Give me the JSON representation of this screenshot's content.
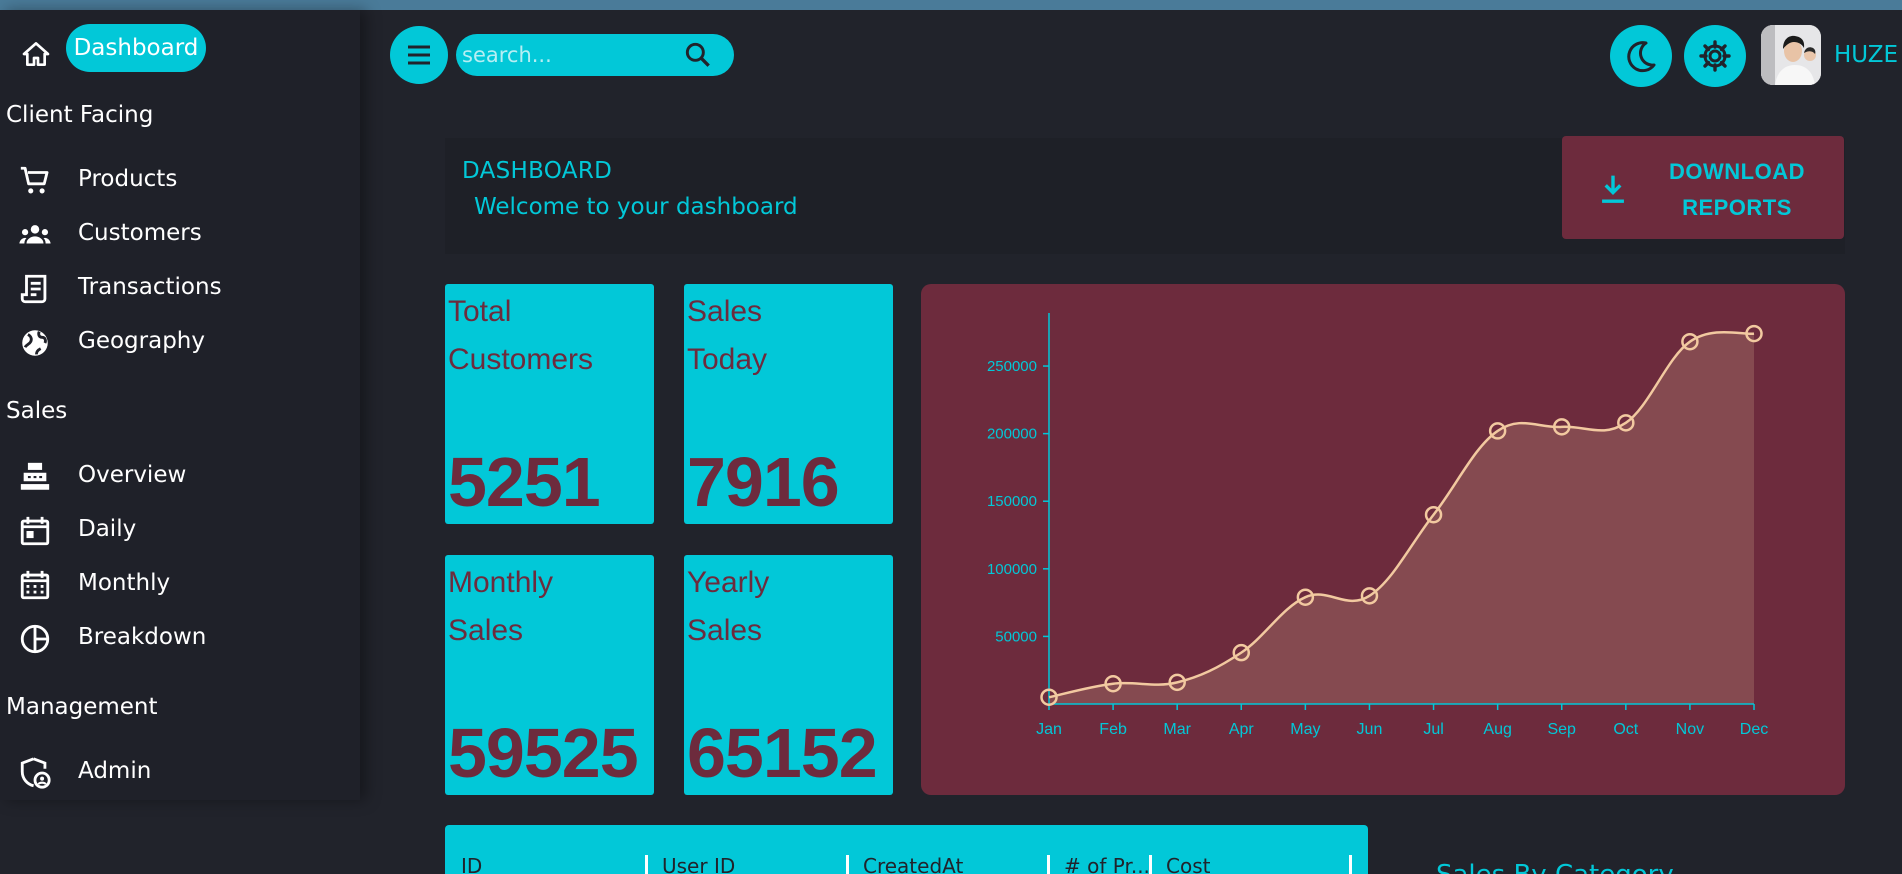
{
  "sidebar": {
    "home_icon": "home-icon",
    "active_item": "Dashboard",
    "sections": [
      {
        "title": "Client Facing",
        "items": [
          {
            "label": "Products",
            "icon": "cart-icon"
          },
          {
            "label": "Customers",
            "icon": "groups-icon"
          },
          {
            "label": "Transactions",
            "icon": "receipt-icon"
          },
          {
            "label": "Geography",
            "icon": "globe-icon"
          }
        ]
      },
      {
        "title": "Sales",
        "items": [
          {
            "label": "Overview",
            "icon": "point-of-sale-icon"
          },
          {
            "label": "Daily",
            "icon": "calendar-today-icon"
          },
          {
            "label": "Monthly",
            "icon": "calendar-month-icon"
          },
          {
            "label": "Breakdown",
            "icon": "pie-chart-icon"
          }
        ]
      },
      {
        "title": "Management",
        "items": [
          {
            "label": "Admin",
            "icon": "admin-shield-icon"
          }
        ]
      }
    ]
  },
  "topbar": {
    "search_placeholder": "search...",
    "icons": [
      "menu-icon",
      "search-icon",
      "dark-mode-icon",
      "settings-icon"
    ],
    "user_name": "HUZE"
  },
  "header": {
    "title": "DASHBOARD",
    "subtitle": "Welcome to your dashboard",
    "download_label_line1": "DOWNLOAD",
    "download_label_line2": "REPORTS"
  },
  "stats": [
    {
      "line1": "Total",
      "line2": "Customers",
      "value": "5251"
    },
    {
      "line1": "Sales",
      "line2": "Today",
      "value": "7916"
    },
    {
      "line1": "Monthly",
      "line2": "Sales",
      "value": "59525"
    },
    {
      "line1": "Yearly",
      "line2": "Sales",
      "value": "65152"
    }
  ],
  "chart_data": {
    "type": "area",
    "categories": [
      "Jan",
      "Feb",
      "Mar",
      "Apr",
      "May",
      "Jun",
      "Jul",
      "Aug",
      "Sep",
      "Oct",
      "Nov",
      "Dec"
    ],
    "values": [
      5000,
      15000,
      16000,
      38000,
      79000,
      80000,
      140000,
      202000,
      205000,
      208000,
      268000,
      274000
    ],
    "yticks": [
      50000,
      100000,
      150000,
      200000,
      250000
    ],
    "ylim": [
      0,
      270000
    ],
    "grid": false,
    "colors": {
      "line": "#f2c9a0",
      "fill": "#8a5053",
      "axis": "#02c8d8",
      "background": "#6d2b3d"
    }
  },
  "table": {
    "columns": [
      "ID",
      "User ID",
      "CreatedAt",
      "# of Pr...",
      "Cost"
    ]
  },
  "side_panel": {
    "title": "Sales By Category"
  },
  "colors": {
    "accent": "#02c8d8",
    "secondary": "#6d2b3d",
    "background": "#21232b"
  }
}
